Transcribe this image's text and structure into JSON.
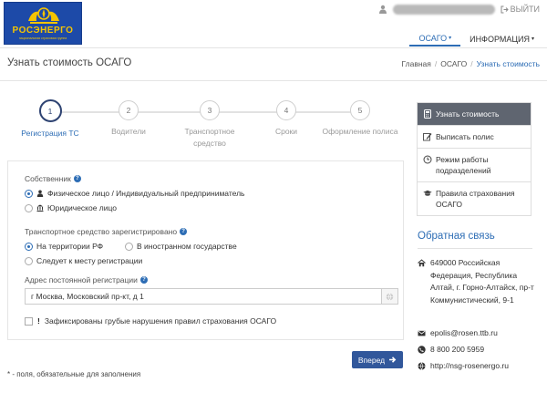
{
  "header": {
    "logo_text": "РОСЭНЕРГО",
    "logo_tagline": "национальная страховая группа",
    "logout_label": "ВЫЙТИ",
    "nav": [
      {
        "label": "ОСАГО",
        "active": true
      },
      {
        "label": "ИНФОРМАЦИЯ",
        "active": false
      }
    ]
  },
  "page": {
    "title": "Узнать стоимость ОСАГО",
    "breadcrumb": [
      "Главная",
      "ОСАГО",
      "Узнать стоимость"
    ]
  },
  "steps": [
    {
      "num": "1",
      "label": "Регистрация ТС",
      "active": true
    },
    {
      "num": "2",
      "label": "Водители",
      "active": false
    },
    {
      "num": "3",
      "label": "Транспортное средство",
      "active": false
    },
    {
      "num": "4",
      "label": "Сроки",
      "active": false
    },
    {
      "num": "5",
      "label": "Оформление полиса",
      "active": false
    }
  ],
  "form": {
    "owner_label": "Собственник",
    "owner_options": [
      {
        "label": "Физическое лицо / Индивидуальный предприниматель",
        "checked": true,
        "icon": "user-icon"
      },
      {
        "label": "Юридическое лицо",
        "checked": false,
        "icon": "bank-icon"
      }
    ],
    "registered_label": "Транспортное средство зарегистрировано",
    "registered_options": [
      {
        "label": "На территории РФ",
        "checked": true
      },
      {
        "label": "В иностранном государстве",
        "checked": false
      },
      {
        "label": "Следует к месту регистрации",
        "checked": false
      }
    ],
    "address_label": "Адрес постоянной регистрации",
    "address_value": "г Москва, Московский пр-кт, д 1",
    "violations_label": "Зафиксированы грубые нарушения правил страхования ОСАГО",
    "next_button": "Вперед",
    "required_note": "* - поля, обязательные для заполнения"
  },
  "sidebar": {
    "menu": [
      {
        "label": "Узнать стоимость",
        "icon": "calculator-icon",
        "active": true
      },
      {
        "label": "Выписать полис",
        "icon": "edit-icon",
        "active": false
      },
      {
        "label": "Режим работы подразделений",
        "icon": "clock-icon",
        "active": false
      },
      {
        "label": "Правила страхования ОСАГО",
        "icon": "graduation-cap-icon",
        "active": false
      }
    ],
    "feedback_title": "Обратная связь",
    "contacts": {
      "address": "649000 Российская Федерация, Республика Алтай, г. Горно-Алтайск, пр-т Коммунистический, 9-1",
      "email": "epolis@rosen.ttb.ru",
      "phone": "8 800 200 5959",
      "website": "http://nsg-rosenergo.ru"
    }
  },
  "colors": {
    "brand_blue": "#1d4aa8",
    "brand_yellow": "#f5c400",
    "accent": "#2d6db5",
    "button": "#31579b",
    "sidebar_active": "#5f6570"
  }
}
